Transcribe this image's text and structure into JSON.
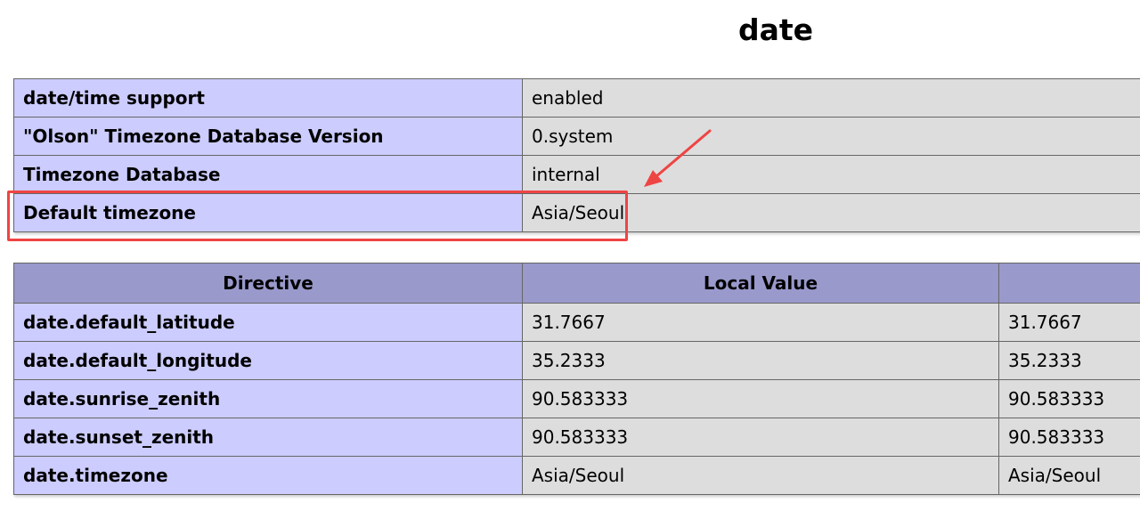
{
  "page": {
    "title": "date"
  },
  "info_table": {
    "rows": [
      {
        "label": "date/time support",
        "value": "enabled"
      },
      {
        "label": "\"Olson\" Timezone Database Version",
        "value": "0.system"
      },
      {
        "label": "Timezone Database",
        "value": "internal"
      },
      {
        "label": "Default timezone",
        "value": "Asia/Seoul"
      }
    ]
  },
  "directive_table": {
    "headers": {
      "directive": "Directive",
      "local_value": "Local Value",
      "master_value": ""
    },
    "rows": [
      {
        "directive": "date.default_latitude",
        "local": "31.7667",
        "master": "31.7667"
      },
      {
        "directive": "date.default_longitude",
        "local": "35.2333",
        "master": "35.2333"
      },
      {
        "directive": "date.sunrise_zenith",
        "local": "90.583333",
        "master": "90.583333"
      },
      {
        "directive": "date.sunset_zenith",
        "local": "90.583333",
        "master": "90.583333"
      },
      {
        "directive": "date.timezone",
        "local": "Asia/Seoul",
        "master": "Asia/Seoul"
      }
    ]
  },
  "annotation": {
    "color": "#ef4444",
    "highlighted_row": "Default timezone"
  },
  "colors": {
    "label_cell": "#ccccff",
    "value_cell": "#dddddd",
    "header_cell": "#9999cc",
    "border": "#666666"
  }
}
